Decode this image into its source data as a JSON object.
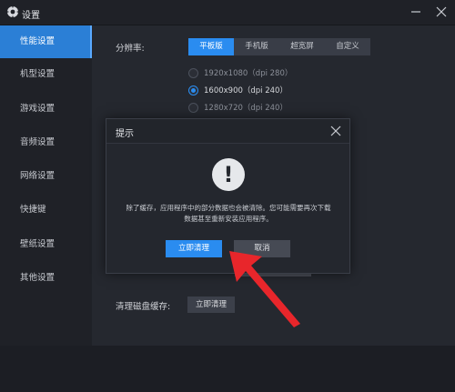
{
  "window": {
    "title": "设置",
    "icon": "gear-icon"
  },
  "sidebar": {
    "items": [
      {
        "label": "性能设置",
        "active": true
      },
      {
        "label": "机型设置"
      },
      {
        "label": "游戏设置"
      },
      {
        "label": "音频设置"
      },
      {
        "label": "网络设置"
      },
      {
        "label": "快捷键"
      },
      {
        "label": "壁纸设置"
      },
      {
        "label": "其他设置"
      }
    ]
  },
  "performance": {
    "resolution_label": "分辨率:",
    "tabs": [
      {
        "label": "平板版",
        "active": true
      },
      {
        "label": "手机版"
      },
      {
        "label": "超宽屏"
      },
      {
        "label": "自定义"
      }
    ],
    "resolutions": [
      {
        "label": "1920x1080（dpi 280）",
        "checked": false
      },
      {
        "label": "1600x900（dpi 240）",
        "checked": true
      },
      {
        "label": "1280x720（dpi 240）",
        "checked": false
      }
    ],
    "cache_label": "清理磁盘缓存:",
    "cache_button": "立即清理"
  },
  "dialog": {
    "title": "提示",
    "icon": "warning-icon",
    "icon_glyph": "!",
    "message_line1": "除了缓存，应用程序中的部分数据也会被清除。您可能需要再次下载",
    "message_line2": "数据甚至重新安装应用程序。",
    "confirm": "立即清理",
    "cancel": "取消"
  },
  "colors": {
    "accent": "#2a8cf0",
    "sidebar_active": "#2b7fd6",
    "arrow": "#e8262b"
  }
}
